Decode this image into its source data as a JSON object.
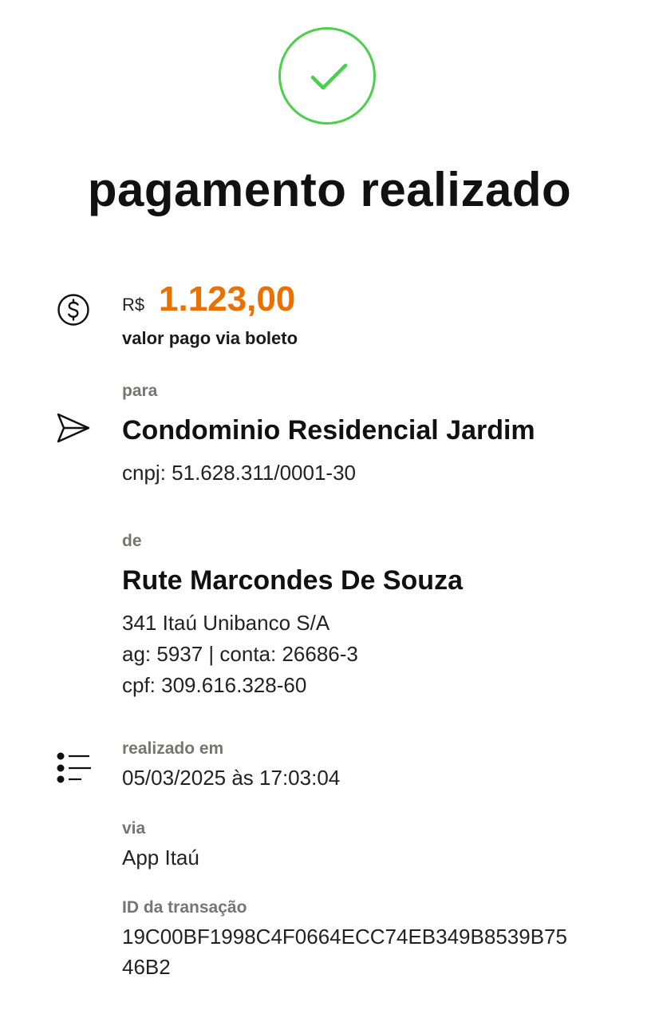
{
  "status": {
    "icon": "check-circle-icon",
    "title": "pagamento realizado",
    "color_success": "#4ccf4c"
  },
  "payment": {
    "icon": "dollar-circle-icon",
    "currency": "R$",
    "amount": "1.123,00",
    "amount_color": "#ec7000",
    "method_label": "valor pago via boleto"
  },
  "recipient": {
    "icon": "send-icon",
    "label": "para",
    "name": "Condominio Residencial Jardim",
    "doc": "cnpj: 51.628.311/0001-30"
  },
  "payer": {
    "label": "de",
    "name": "Rute Marcondes De Souza",
    "bank": "341 Itaú Unibanco S/A",
    "account": "ag: 5937 | conta: 26686-3",
    "doc": "cpf: 309.616.328-60"
  },
  "details": {
    "icon": "list-icon",
    "date_label": "realizado em",
    "date_value": "05/03/2025 às 17:03:04",
    "via_label": "via",
    "via_value": "App Itaú",
    "id_label": "ID da transação",
    "id_line1": "19C00BF1998C4F0664ECC74EB349B8539B75",
    "id_line2": "46B2"
  }
}
